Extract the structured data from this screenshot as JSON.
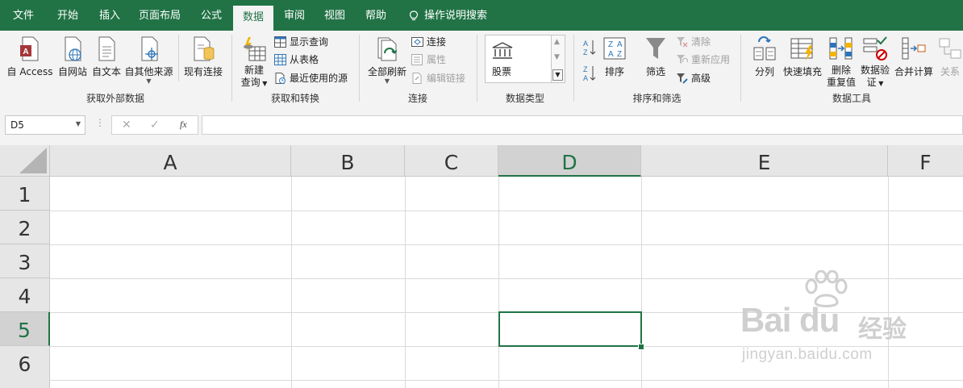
{
  "menu": {
    "tabs": [
      "文件",
      "开始",
      "插入",
      "页面布局",
      "公式",
      "数据",
      "审阅",
      "视图",
      "帮助"
    ],
    "active_tab": "数据",
    "search_label": "操作说明搜索"
  },
  "ribbon": {
    "get_external": {
      "label": "获取外部数据",
      "from_access": "自 Access",
      "from_web": "自网站",
      "from_text": "自文本",
      "from_other": "自其他来源",
      "existing": "现有连接"
    },
    "get_transform": {
      "label": "获取和转换",
      "new_query_line1": "新建",
      "new_query_line2": "查询",
      "show_queries": "显示查询",
      "from_table": "从表格",
      "recent_sources": "最近使用的源"
    },
    "connections": {
      "label": "连接",
      "refresh_all": "全部刷新",
      "connections": "连接",
      "properties": "属性",
      "edit_links": "编辑链接"
    },
    "data_types": {
      "label": "数据类型",
      "stocks": "股票"
    },
    "sort_filter": {
      "label": "排序和筛选",
      "sort": "排序",
      "filter": "筛选",
      "clear": "清除",
      "reapply": "重新应用",
      "advanced": "高级"
    },
    "data_tools": {
      "label": "数据工具",
      "text_to_columns": "分列",
      "flash_fill": "快速填充",
      "remove_dup_line1": "删除",
      "remove_dup_line2": "重复值",
      "validation_line1": "数据验",
      "validation_line2": "证",
      "consolidate": "合并计算",
      "relationships": "关系"
    }
  },
  "formula_bar": {
    "name_box": "D5",
    "fx": "fx",
    "formula": ""
  },
  "sheet": {
    "columns": [
      "A",
      "B",
      "C",
      "D",
      "E",
      "F"
    ],
    "rows": [
      "1",
      "2",
      "3",
      "4",
      "5",
      "6"
    ],
    "selected_col": "D",
    "selected_row": "5"
  },
  "watermark": {
    "brand": "Bai du",
    "cn": "经验",
    "url": "jingyan.baidu.com"
  },
  "colors": {
    "accent": "#217346",
    "ribbon_bg": "#f3f3f3",
    "header_bg": "#e6e6e6"
  }
}
